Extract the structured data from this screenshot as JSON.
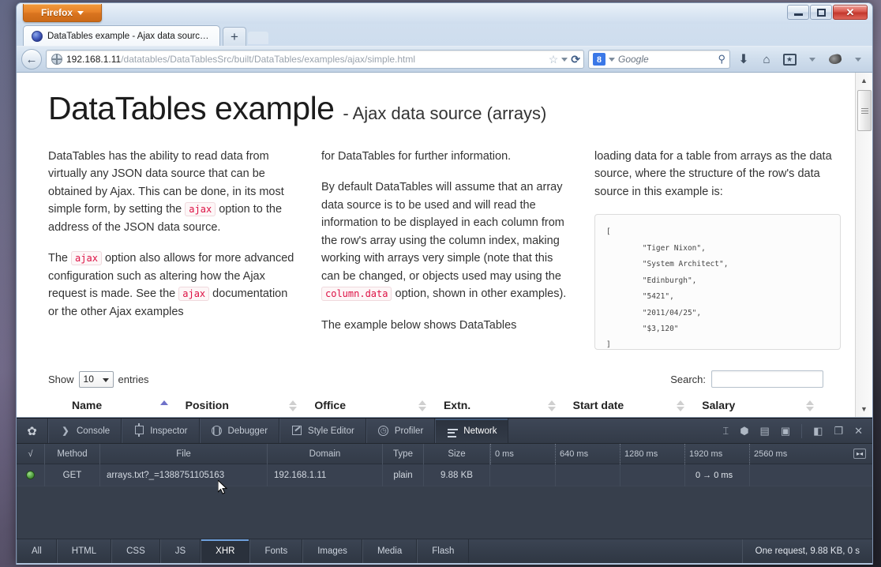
{
  "window": {
    "firefox_button": "Firefox",
    "minimize": "minimize",
    "maximize": "maximize",
    "close": "✕"
  },
  "tabs": {
    "active_title": "DataTables example - Ajax data source (...",
    "new_tab": "+"
  },
  "navbar": {
    "url_host": "192.168.1.11",
    "url_path": "/datatables/DataTablesSrc/built/DataTables/examples/ajax/simple.html",
    "search_engine": "Google",
    "g_letter": "8"
  },
  "page": {
    "title_main": "DataTables example",
    "title_sub": "- Ajax data source (arrays)",
    "columns": [
      {
        "paragraphs": [
          [
            {
              "t": "text",
              "v": "DataTables has the ability to read data from virtually any JSON data source that can be obtained by Ajax. This can be done, in its most simple form, by setting the "
            },
            {
              "t": "code",
              "v": "ajax"
            },
            {
              "t": "text",
              "v": " option to the address of the JSON data source."
            }
          ],
          [
            {
              "t": "text",
              "v": "The "
            },
            {
              "t": "code",
              "v": "ajax"
            },
            {
              "t": "text",
              "v": " option also allows for more advanced configuration such as altering how the Ajax request is made. See the "
            },
            {
              "t": "code",
              "v": "ajax"
            },
            {
              "t": "text",
              "v": " documentation or the other Ajax examples"
            }
          ]
        ]
      },
      {
        "paragraphs": [
          [
            {
              "t": "text",
              "v": "for DataTables for further information."
            }
          ],
          [
            {
              "t": "text",
              "v": "By default DataTables will assume that an array data source is to be used and will read the information to be displayed in each column from the row's array using the column index, making working with arrays very simple (note that this can be changed, or objects used may using the "
            },
            {
              "t": "code",
              "v": "column.data"
            },
            {
              "t": "text",
              "v": " option, shown in other examples)."
            }
          ],
          [
            {
              "t": "text",
              "v": "The example below shows DataTables"
            }
          ]
        ]
      },
      {
        "paragraphs": [
          [
            {
              "t": "text",
              "v": "loading data for a table from arrays as the data source, where the structure of the row's data source in this example is:"
            }
          ]
        ],
        "code_block": "[\n        \"Tiger Nixon\",\n        \"System Architect\",\n        \"Edinburgh\",\n        \"5421\",\n        \"2011/04/25\",\n        \"$3,120\"\n]"
      }
    ],
    "datatable": {
      "show_label": "Show",
      "length_value": "10",
      "entries_label": "entries",
      "search_label": "Search:",
      "search_value": "",
      "headers": [
        {
          "label": "Name",
          "sorted": true
        },
        {
          "label": "Position",
          "sorted": false
        },
        {
          "label": "Office",
          "sorted": false
        },
        {
          "label": "Extn.",
          "sorted": false
        },
        {
          "label": "Start date",
          "sorted": false
        },
        {
          "label": "Salary",
          "sorted": false
        }
      ]
    }
  },
  "devtools": {
    "tabs": [
      {
        "label": "Console",
        "icon": "console-icon",
        "active": false
      },
      {
        "label": "Inspector",
        "icon": "inspector-icon",
        "active": false
      },
      {
        "label": "Debugger",
        "icon": "debugger-icon",
        "active": false
      },
      {
        "label": "Style Editor",
        "icon": "style-editor-icon",
        "active": false
      },
      {
        "label": "Profiler",
        "icon": "profiler-icon",
        "active": false
      },
      {
        "label": "Network",
        "icon": "network-icon",
        "active": true
      }
    ],
    "network": {
      "headers": {
        "check": "√",
        "method": "Method",
        "file": "File",
        "domain": "Domain",
        "type": "Type",
        "size": "Size"
      },
      "timeline_ticks": [
        "0 ms",
        "640 ms",
        "1280 ms",
        "1920 ms",
        "2560 ms"
      ],
      "rows": [
        {
          "status": "success",
          "method": "GET",
          "file": "arrays.txt?_=1388751105163",
          "domain": "192.168.1.11",
          "type": "plain",
          "size": "9.88 KB",
          "timing": "0 → 0 ms"
        }
      ]
    },
    "filters": [
      {
        "label": "All",
        "active": false
      },
      {
        "label": "HTML",
        "active": false
      },
      {
        "label": "CSS",
        "active": false
      },
      {
        "label": "JS",
        "active": false
      },
      {
        "label": "XHR",
        "active": true
      },
      {
        "label": "Fonts",
        "active": false
      },
      {
        "label": "Images",
        "active": false
      },
      {
        "label": "Media",
        "active": false
      },
      {
        "label": "Flash",
        "active": false
      }
    ],
    "status": "One request, 9.88 KB, 0 s"
  }
}
